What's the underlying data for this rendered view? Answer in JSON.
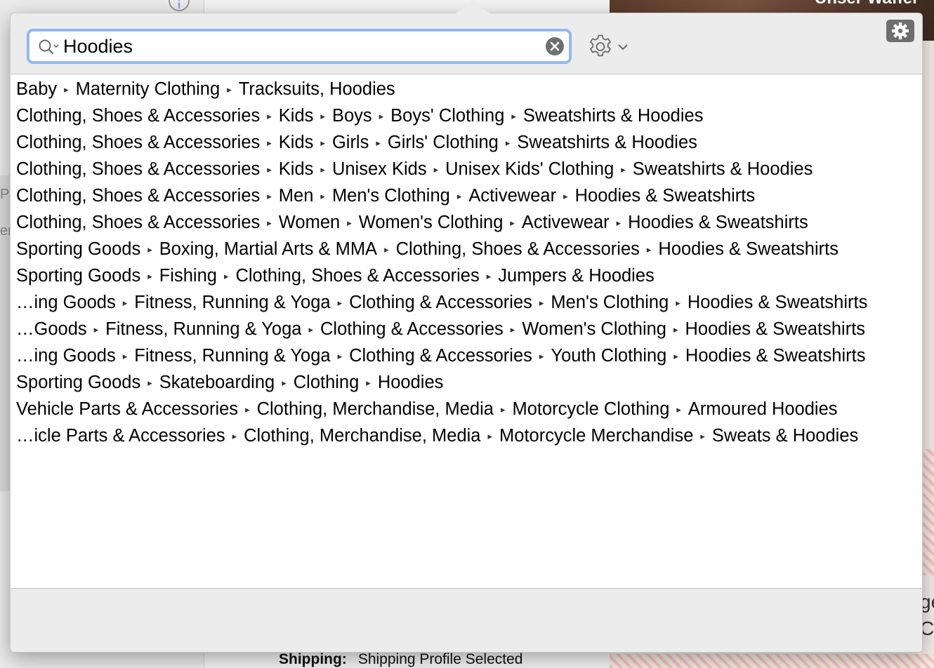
{
  "background": {
    "header_title": "Unser Waffel",
    "left_fragments": [
      "Pr",
      "er"
    ],
    "right_fragments": [
      "ge",
      "CF"
    ],
    "shipping_label": "Shipping:",
    "shipping_value": "Shipping Profile Selected"
  },
  "search": {
    "value": "Hoodies",
    "icon": "search-icon",
    "clear_icon": "clear-icon"
  },
  "toolbar": {
    "gear_icon": "gear-icon",
    "chevron_icon": "chevron-down-icon",
    "corner_icon": "gear-icon"
  },
  "separator": "▸",
  "results": [
    [
      "Baby",
      "Maternity Clothing",
      "Tracksuits, Hoodies"
    ],
    [
      "Clothing, Shoes & Accessories",
      "Kids",
      "Boys",
      "Boys' Clothing",
      "Sweatshirts & Hoodies"
    ],
    [
      "Clothing, Shoes & Accessories",
      "Kids",
      "Girls",
      "Girls' Clothing",
      "Sweatshirts & Hoodies"
    ],
    [
      "Clothing, Shoes & Accessories",
      "Kids",
      "Unisex Kids",
      "Unisex Kids' Clothing",
      "Sweatshirts & Hoodies"
    ],
    [
      "Clothing, Shoes & Accessories",
      "Men",
      "Men's Clothing",
      "Activewear",
      "Hoodies & Sweatshirts"
    ],
    [
      "Clothing, Shoes & Accessories",
      "Women",
      "Women's Clothing",
      "Activewear",
      "Hoodies & Sweatshirts"
    ],
    [
      "Sporting Goods",
      "Boxing, Martial Arts & MMA",
      "Clothing, Shoes & Accessories",
      "Hoodies & Sweatshirts"
    ],
    [
      "Sporting Goods",
      "Fishing",
      "Clothing, Shoes & Accessories",
      "Jumpers & Hoodies"
    ],
    [
      "…ing Goods",
      "Fitness, Running & Yoga",
      "Clothing & Accessories",
      "Men's Clothing",
      "Hoodies & Sweatshirts"
    ],
    [
      "…Goods",
      "Fitness, Running & Yoga",
      "Clothing & Accessories",
      "Women's Clothing",
      "Hoodies & Sweatshirts"
    ],
    [
      "…ing Goods",
      "Fitness, Running & Yoga",
      "Clothing & Accessories",
      "Youth Clothing",
      "Hoodies & Sweatshirts"
    ],
    [
      "Sporting Goods",
      "Skateboarding",
      "Clothing",
      "Hoodies"
    ],
    [
      "Vehicle Parts & Accessories",
      "Clothing, Merchandise, Media",
      "Motorcycle Clothing",
      "Armoured Hoodies"
    ],
    [
      "…icle Parts & Accessories",
      "Clothing, Merchandise, Media",
      "Motorcycle Merchandise",
      "Sweats & Hoodies"
    ]
  ]
}
